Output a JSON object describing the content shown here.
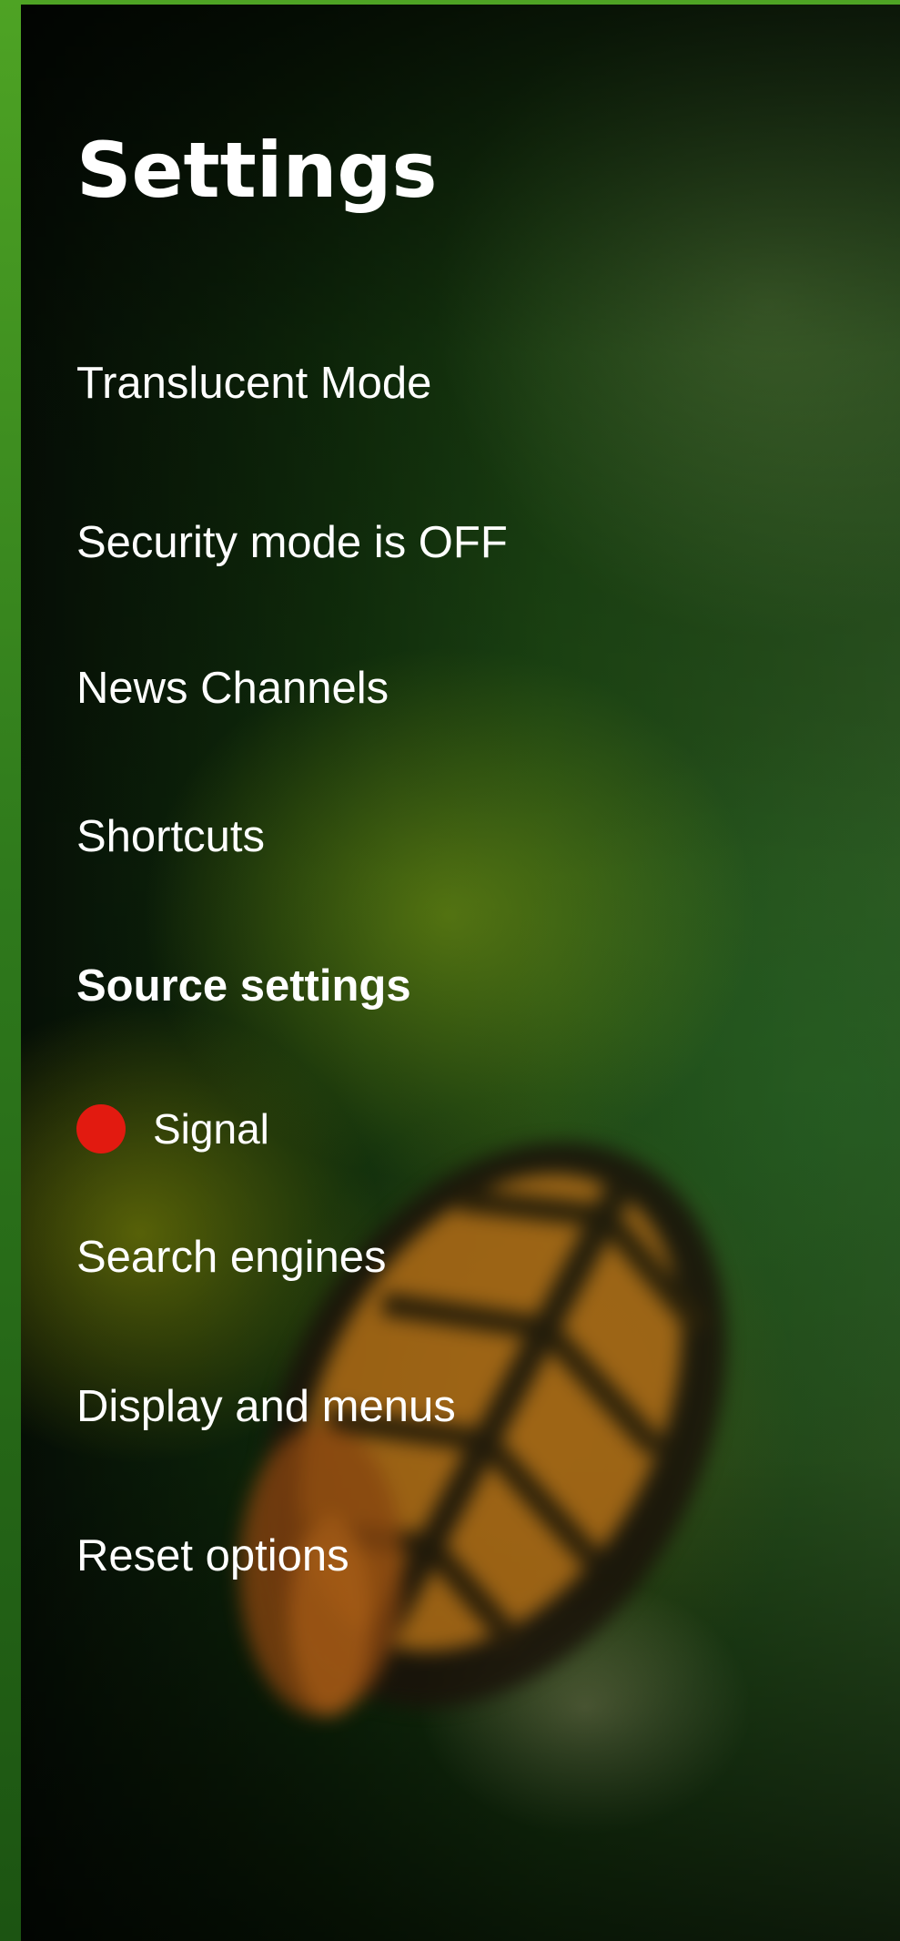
{
  "header": {
    "title": "Settings"
  },
  "menu": {
    "translucent_mode": "Translucent Mode",
    "security_mode": "Security mode is OFF",
    "news_channels": "News Channels",
    "shortcuts": "Shortcuts",
    "source_settings": "Source settings",
    "signal": {
      "label": "Signal",
      "status_color": "#e21a10"
    },
    "search_engines": "Search engines",
    "display_and_menus": "Display and menus",
    "reset_options": "Reset options"
  }
}
